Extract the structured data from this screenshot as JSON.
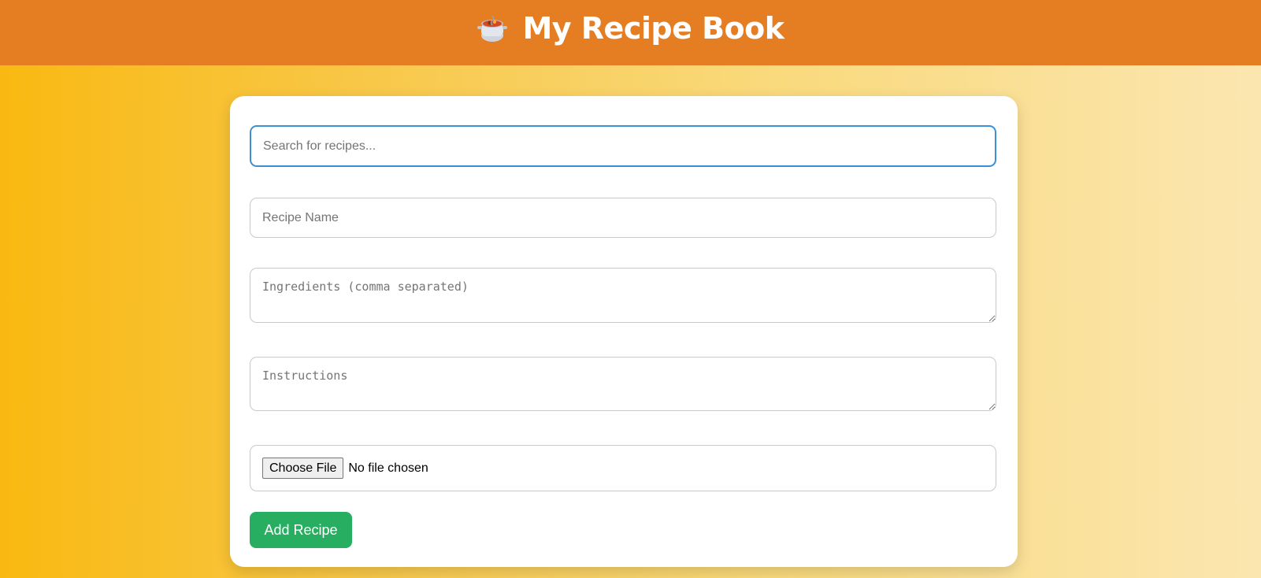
{
  "header": {
    "title": "My Recipe Book",
    "icon": "cooking-pot-icon"
  },
  "form": {
    "search_placeholder": "Search for recipes...",
    "recipe_name_placeholder": "Recipe Name",
    "ingredients_placeholder": "Ingredients (comma separated)",
    "instructions_placeholder": "Instructions",
    "file_button_label": "Choose File",
    "file_status": "No file chosen",
    "add_button_label": "Add Recipe"
  },
  "colors": {
    "header_bg": "#e57d22",
    "search_focus_border": "#3b8fd4",
    "add_button_bg": "#27ae60"
  }
}
